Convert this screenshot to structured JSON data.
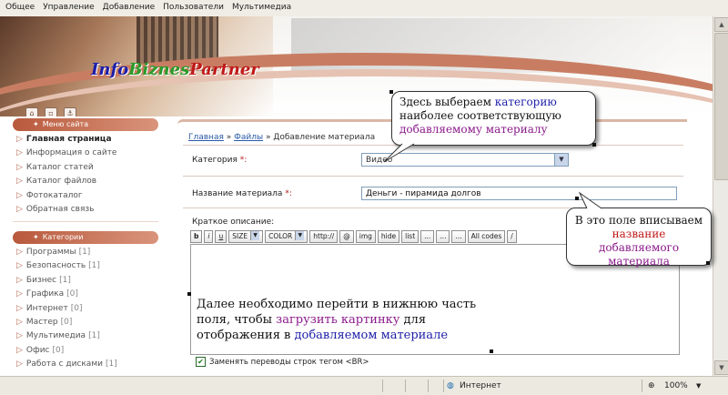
{
  "admin_menu": [
    "Общее",
    "Управление",
    "Добавление",
    "Пользователи",
    "Мультимедиа"
  ],
  "logo": {
    "part1": "Info",
    "part2": "Biznes",
    "part3": "Partner"
  },
  "header_icons": [
    "home-icon",
    "lock-icon",
    "anchor-icon"
  ],
  "sidebar": {
    "menu_title": "Меню сайта",
    "menu_items": [
      "Главная страница",
      "Информация о сайте",
      "Каталог статей",
      "Каталог файлов",
      "Фотокаталог",
      "Обратная связь"
    ],
    "categories_title": "Категории",
    "categories": [
      {
        "label": "Программы",
        "count": "[1]"
      },
      {
        "label": "Безопасность",
        "count": "[1]"
      },
      {
        "label": "Бизнес",
        "count": "[1]"
      },
      {
        "label": "Графика",
        "count": "[0]"
      },
      {
        "label": "Интернет",
        "count": "[0]"
      },
      {
        "label": "Мастер",
        "count": "[0]"
      },
      {
        "label": "Мультимедиа",
        "count": "[1]"
      },
      {
        "label": "Офис",
        "count": "[0]"
      },
      {
        "label": "Работа с дисками",
        "count": "[1]"
      }
    ]
  },
  "breadcrumb": {
    "home": "Главная",
    "sep1": " » ",
    "files": "Файлы",
    "sep2": " » ",
    "current": "Добавление материала"
  },
  "form": {
    "category_label": "Категория",
    "category_value": "Видео",
    "title_label": "Название материала",
    "title_value": "Деньги - пирамида долгов",
    "required_mark": "*:",
    "desc_label": "Краткое описание:",
    "toolbar": [
      "b",
      "i",
      "u",
      "SIZE",
      "COLOR",
      "http://",
      "@",
      "img",
      "hide",
      "list",
      "...",
      "...",
      "...",
      "All codes",
      "/"
    ],
    "newlines_label": "Заменять переводы строк тегом <BR>"
  },
  "status": {
    "zone": "Интернет",
    "zoom": "100%"
  },
  "callouts": {
    "c1": {
      "l1a": "Здесь выбераем ",
      "l1b": "категорию",
      "l2": "наиболее соответствующую",
      "l3": "добавляемому материалу"
    },
    "c2": {
      "l1": "В это поле вписываем",
      "l2a": "название ",
      "l2b": "добавляемого",
      "l3": "материала"
    },
    "c3": {
      "l1": "Далее необходимо перейти в нижнюю часть",
      "l2a": "поля, чтобы ",
      "l2b": "загрузить картинку",
      "l2c": " для",
      "l3a": "отображения в ",
      "l3b": "добавляемом материале"
    }
  }
}
